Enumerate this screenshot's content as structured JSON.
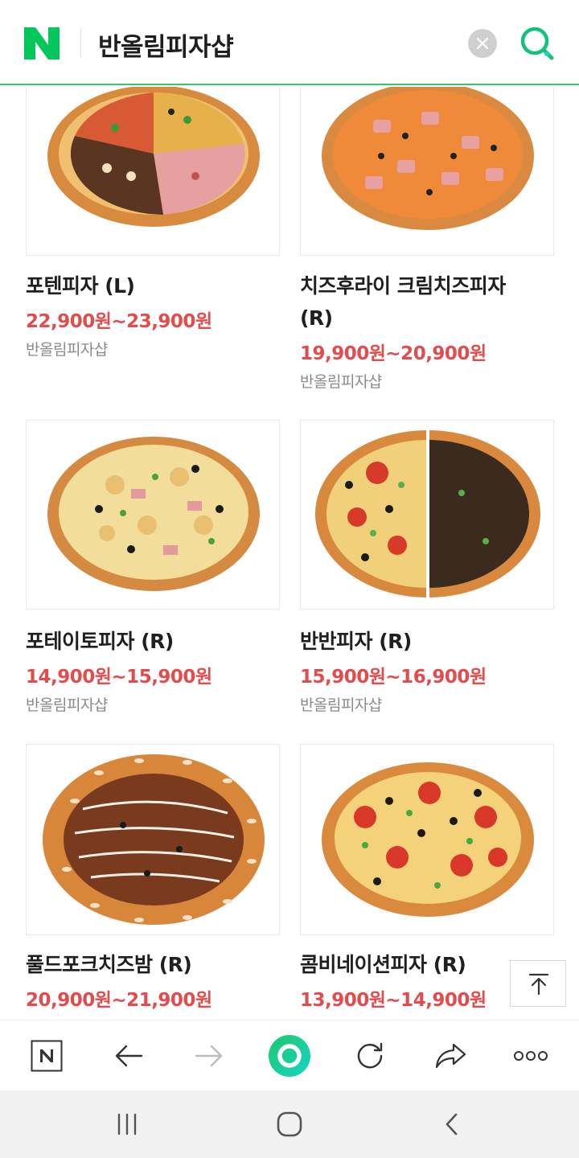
{
  "header": {
    "logo_letter": "N",
    "search_query": "반올림피자샵",
    "brand_color": "#03c75a",
    "accent_line_color": "#3ac56b"
  },
  "products": [
    {
      "name": "포텐피자 (L)",
      "price": "22,900원~23,900원",
      "store": "반올림피자샵",
      "image": "four-topping-pizza"
    },
    {
      "name": "치즈후라이 크림치즈피자 (R)",
      "price": "19,900원~20,900원",
      "store": "반올림피자샵",
      "image": "cheese-fries-pizza"
    },
    {
      "name": "포테이토피자 (R)",
      "price": "14,900원~15,900원",
      "store": "반올림피자샵",
      "image": "potato-pizza"
    },
    {
      "name": "반반피자 (R)",
      "price": "15,900원~16,900원",
      "store": "반올림피자샵",
      "image": "half-half-pizza"
    },
    {
      "name": "풀드포크치즈밤 (R)",
      "price": "20,900원~21,900원",
      "store": "",
      "image": "pulled-pork-pizza"
    },
    {
      "name": "콤비네이션피자 (R)",
      "price": "13,900원~14,900원",
      "store": "",
      "image": "combination-pizza"
    }
  ],
  "price_color": "#e24c4c",
  "toolbar": {
    "items": [
      "naver-home",
      "back",
      "forward",
      "green-dot",
      "refresh",
      "share",
      "more"
    ]
  }
}
